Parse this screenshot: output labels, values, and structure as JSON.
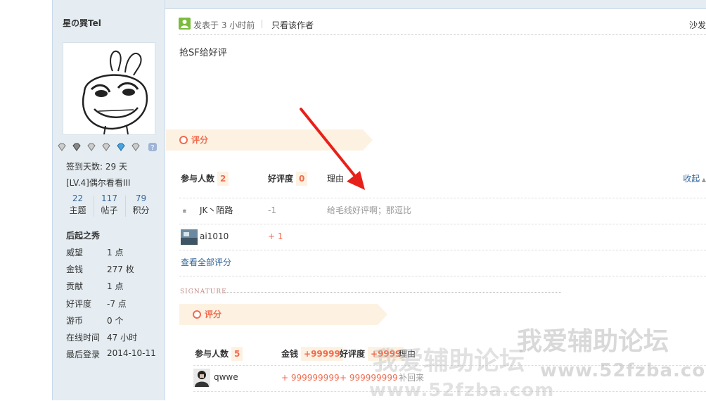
{
  "author": {
    "name": "星の巽Tel",
    "checkin": "签到天数: 29 天",
    "level": "[LV.4]偶尔看看III",
    "counts": [
      {
        "value": "22",
        "label": "主题"
      },
      {
        "value": "117",
        "label": "帖子"
      },
      {
        "value": "79",
        "label": "积分"
      }
    ],
    "group": "后起之秀",
    "profile": [
      {
        "key": "威望",
        "value": "1 点"
      },
      {
        "key": "金钱",
        "value": "277 枚"
      },
      {
        "key": "贡献",
        "value": "1 点"
      },
      {
        "key": "好评度",
        "value": "-7 点"
      },
      {
        "key": "游币",
        "value": "0 个"
      },
      {
        "key": "在线时间",
        "value": "47 小时"
      },
      {
        "key": "最后登录",
        "value": "2014-10-11"
      }
    ],
    "medal_icons": [
      "diamond-icon",
      "diamond-icon",
      "diamond-icon",
      "diamond-icon",
      "blue-diamond-icon",
      "diamond-icon",
      "question-icon"
    ]
  },
  "post": {
    "time": "发表于 3 小时前",
    "only_author": "只看该作者",
    "floor": "沙发",
    "content": "抢SF给好评"
  },
  "rating1": {
    "title": "评分",
    "participants_label": "参与人数",
    "participants": "2",
    "rep_label": "好评度",
    "rep_total": "0",
    "reason_label": "理由",
    "collapse": "收起",
    "rows": [
      {
        "user": "JK丶陌路",
        "rep": "-1",
        "reason": "给毛线好评啊；那逗比"
      },
      {
        "user": "ai1010",
        "rep": "+ 1",
        "reason": ""
      }
    ],
    "view_all": "查看全部评分"
  },
  "signature_label": "SIGNATURE",
  "rating2": {
    "title": "评分",
    "participants_label": "参与人数",
    "participants": "5",
    "money_label": "金钱",
    "money_total": "+99999",
    "rep_label": "好评度",
    "rep_total": "+9999",
    "reason_label": "理由",
    "rows": [
      {
        "user": "qwwe",
        "money": "+ 999999999",
        "rep": "+ 999999999",
        "reason": "补回来"
      }
    ]
  },
  "watermark": {
    "title": "我爱辅助论坛",
    "url": "www.52fzba.com"
  },
  "colors": {
    "accent": "#f26c4f",
    "link": "#336699",
    "sidebar_bg": "#e5edf2",
    "banner_bg": "#fdf2e2"
  }
}
